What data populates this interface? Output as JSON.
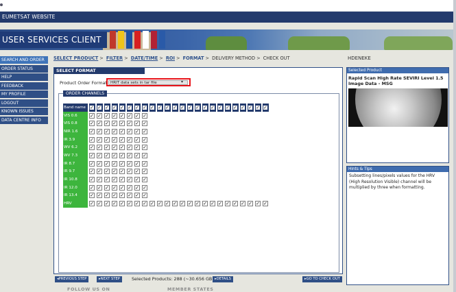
{
  "site": {
    "bar_label": "EUMETSAT WEBSITE"
  },
  "banner": {
    "title": "USER SERVICES CLIENT"
  },
  "nav": {
    "items": [
      {
        "label": "SEARCH AND ORDER",
        "active": true
      },
      {
        "label": "ORDER STATUS"
      },
      {
        "label": "HELP"
      },
      {
        "label": "FEEDBACK"
      },
      {
        "label": "MY PROFILE"
      },
      {
        "label": "LOGOUT"
      },
      {
        "label": "KNOWN ISSUES"
      },
      {
        "label": "DATA CENTRE INFO"
      }
    ]
  },
  "breadcrumb": {
    "steps": [
      "SELECT PRODUCT",
      "FILTER",
      "DATE/TIME",
      "ROI",
      "FORMAT",
      "DELIVERY METHOD",
      "CHECK OUT"
    ]
  },
  "user": {
    "name": "HDENEKE"
  },
  "main": {
    "header": "SELECT FORMAT",
    "format_label": "Product Order Format:",
    "format_value": "HRIT data sets in tar file"
  },
  "channels": {
    "title": "ORDER CHANNELS",
    "band_header": "Band name",
    "rows": [
      {
        "name": "VIS 0.6"
      },
      {
        "name": "VIS 0.8"
      },
      {
        "name": "NIR 1.6"
      },
      {
        "name": "IR 3.9"
      },
      {
        "name": "WV 6.2"
      },
      {
        "name": "WV 7.3"
      },
      {
        "name": "IR 8.7"
      },
      {
        "name": "IR 9.7"
      },
      {
        "name": "IR 10.8"
      },
      {
        "name": "IR 12.0"
      },
      {
        "name": "IR 13.4"
      },
      {
        "name": "HRV"
      }
    ],
    "check_glyph": "✓"
  },
  "selected_product": {
    "header": "Selected Product",
    "title": "Rapid Scan High Rate SEVIRI Level 1.5 Image Data - MSG"
  },
  "hints": {
    "header": "Hints & Tips",
    "text": "Subsetting lines/pixels values for the HRV (High Resolution Visible) channel will be multiplied by three when formatting."
  },
  "bottom": {
    "prev_label": "PREVIOUS STEP",
    "next_label": "NEXT STEP",
    "selected_products": "Selected Products: 288 (~30.656 GB)",
    "details_label": "DETAILS",
    "checkout_label": "GO TO CHECK OUT"
  },
  "footer": {
    "follow": "FOLLOW US ON",
    "member": "MEMBER STATES"
  },
  "colors": {
    "navy": "#233a6c",
    "nav_blue": "#2f4f86",
    "green": "#3db53d",
    "highlight_red": "#e8141a"
  }
}
